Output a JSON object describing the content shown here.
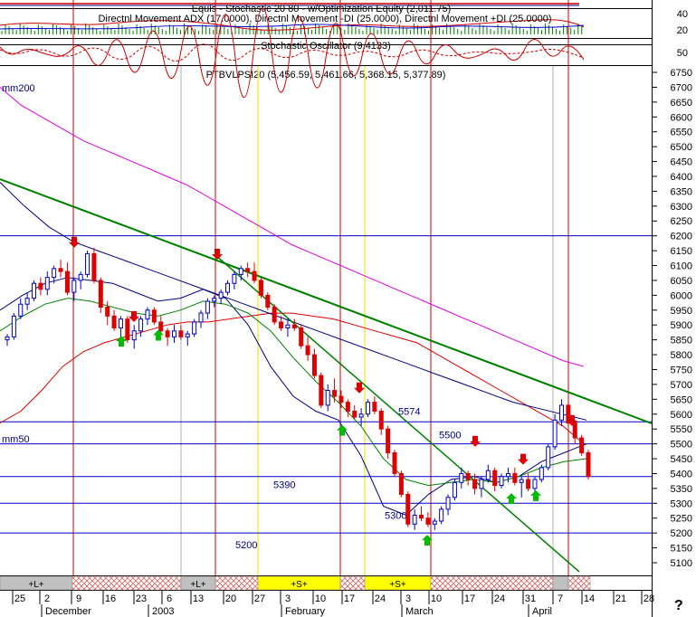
{
  "headers": {
    "equity": "Equis - Stochastic 20 80 - w/Optimization Equity (2,011.75)",
    "adx": "Directnl Movement ADX (17.0000), Directnl Movement -DI (25.0000), Directnl Movement +DI (25.0000)",
    "stoch": "Stochastic Oscillator (9.4133)",
    "price": "PTBVLPSI20 (5,456.59, 5,461.66, 5,368.15, 5,377.89)"
  },
  "panel_scales": {
    "equity": [
      "40"
    ],
    "adx": [
      "20"
    ],
    "stoch": [
      "50"
    ]
  },
  "labels": {
    "mm200": "mm200",
    "mm50": "mm50",
    "corner": "?"
  },
  "colors": {
    "up_candle": "#0000cc",
    "down_candle": "#dd0000",
    "mm200": "#dd00dd",
    "mm50": "#dd0000",
    "mm_blue": "#000080",
    "mm_green": "#008000",
    "trendline": "#008000",
    "support_line": "#0000cc",
    "buy_arrow": "#00bb00",
    "sell_arrow": "#dd0000",
    "red_vline": "#cc0000",
    "yellow_vline": "#e6e600",
    "gray_vline": "#b0b0b0"
  },
  "chart_data": {
    "type": "candlestick",
    "symbol": "PTBVLPSI20",
    "ylim": [
      5050,
      6800
    ],
    "yticks": [
      5100,
      5150,
      5200,
      5250,
      5300,
      5350,
      5400,
      5450,
      5500,
      5550,
      5600,
      5650,
      5700,
      5750,
      5800,
      5850,
      5900,
      5950,
      6000,
      6050,
      6100,
      6150,
      6200,
      6250,
      6300,
      6350,
      6400,
      6450,
      6500,
      6550,
      6600,
      6650,
      6700,
      6750
    ],
    "ytick_labels": [
      "5100",
      "5150",
      "5200",
      "5250",
      "5300",
      "5350",
      "5400",
      "5450",
      "5500",
      "5550",
      "5600",
      "5650",
      "5700",
      "5750",
      "5800",
      "5850",
      "5900",
      "5950",
      "6000",
      "6050",
      "6100",
      "6150",
      "6200",
      "6250",
      "6300",
      "6350",
      "6400",
      "6450",
      "6500",
      "6550",
      "6600",
      "6650",
      "6700",
      "6750"
    ],
    "xtick_labels": [
      "25",
      "2",
      "9",
      "16",
      "23",
      "6",
      "13",
      "20",
      "27",
      "3",
      "10",
      "17",
      "24",
      "3",
      "10",
      "17",
      "24",
      "31",
      "7",
      "14",
      "21",
      "28"
    ],
    "month_labels": [
      "December",
      "2003",
      "February",
      "March",
      "April"
    ],
    "horizontal_levels": [
      {
        "value": 6200,
        "label": ""
      },
      {
        "value": 5574,
        "label": "5574"
      },
      {
        "value": 5500,
        "label": "5500"
      },
      {
        "value": 5390,
        "label": "5390"
      },
      {
        "value": 5300,
        "label": "5300"
      },
      {
        "value": 5200,
        "label": "5200"
      }
    ],
    "signal_bar": [
      {
        "label": "+L+",
        "type": "long"
      },
      {
        "label": "",
        "type": "none"
      },
      {
        "label": "+L+",
        "type": "long"
      },
      {
        "label": "",
        "type": "none"
      },
      {
        "label": "+S+",
        "type": "short"
      },
      {
        "label": "",
        "type": "none"
      },
      {
        "label": "+S+",
        "type": "short"
      },
      {
        "label": "",
        "type": "none"
      },
      {
        "label": "",
        "type": "long"
      },
      {
        "label": "",
        "type": "none"
      }
    ],
    "candles": [
      [
        5850,
        5870,
        5830,
        5860
      ],
      [
        5860,
        5940,
        5850,
        5930
      ],
      [
        5930,
        5990,
        5920,
        5970
      ],
      [
        5970,
        6010,
        5950,
        5990
      ],
      [
        5990,
        6050,
        5980,
        6040
      ],
      [
        6040,
        6060,
        6000,
        6020
      ],
      [
        6020,
        6080,
        6000,
        6060
      ],
      [
        6060,
        6100,
        6040,
        6090
      ],
      [
        6090,
        6120,
        6060,
        6080
      ],
      [
        6080,
        6110,
        6000,
        6010
      ],
      [
        6010,
        6060,
        5980,
        6050
      ],
      [
        6050,
        6080,
        6020,
        6070
      ],
      [
        6070,
        6150,
        6060,
        6140
      ],
      [
        6140,
        6160,
        6040,
        6050
      ],
      [
        6050,
        6060,
        5940,
        5960
      ],
      [
        5960,
        5980,
        5900,
        5930
      ],
      [
        5930,
        5950,
        5880,
        5890
      ],
      [
        5890,
        5930,
        5860,
        5920
      ],
      [
        5920,
        5930,
        5840,
        5850
      ],
      [
        5850,
        5900,
        5820,
        5880
      ],
      [
        5880,
        5930,
        5860,
        5920
      ],
      [
        5920,
        5960,
        5900,
        5950
      ],
      [
        5950,
        5960,
        5900,
        5910
      ],
      [
        5910,
        5930,
        5870,
        5880
      ],
      [
        5880,
        5890,
        5830,
        5860
      ],
      [
        5860,
        5900,
        5840,
        5880
      ],
      [
        5880,
        5900,
        5850,
        5860
      ],
      [
        5860,
        5880,
        5830,
        5870
      ],
      [
        5870,
        5920,
        5860,
        5910
      ],
      [
        5910,
        5950,
        5890,
        5940
      ],
      [
        5940,
        5990,
        5920,
        5980
      ],
      [
        5980,
        6000,
        5960,
        5990
      ],
      [
        5990,
        6020,
        5970,
        6010
      ],
      [
        6010,
        6050,
        6000,
        6040
      ],
      [
        6040,
        6080,
        6020,
        6070
      ],
      [
        6070,
        6100,
        6050,
        6090
      ],
      [
        6090,
        6110,
        6060,
        6080
      ],
      [
        6080,
        6110,
        6040,
        6050
      ],
      [
        6050,
        6060,
        5990,
        6000
      ],
      [
        6000,
        6010,
        5950,
        5960
      ],
      [
        5960,
        5970,
        5900,
        5910
      ],
      [
        5910,
        5930,
        5880,
        5890
      ],
      [
        5890,
        5920,
        5860,
        5900
      ],
      [
        5900,
        5920,
        5880,
        5890
      ],
      [
        5890,
        5900,
        5820,
        5830
      ],
      [
        5830,
        5860,
        5780,
        5800
      ],
      [
        5800,
        5820,
        5720,
        5730
      ],
      [
        5730,
        5740,
        5620,
        5630
      ],
      [
        5630,
        5700,
        5610,
        5680
      ],
      [
        5680,
        5720,
        5640,
        5660
      ],
      [
        5660,
        5680,
        5620,
        5640
      ],
      [
        5640,
        5650,
        5590,
        5610
      ],
      [
        5610,
        5630,
        5580,
        5590
      ],
      [
        5590,
        5620,
        5560,
        5600
      ],
      [
        5600,
        5650,
        5590,
        5640
      ],
      [
        5640,
        5660,
        5600,
        5610
      ],
      [
        5610,
        5620,
        5530,
        5550
      ],
      [
        5550,
        5560,
        5450,
        5470
      ],
      [
        5470,
        5480,
        5390,
        5400
      ],
      [
        5400,
        5410,
        5320,
        5330
      ],
      [
        5330,
        5340,
        5220,
        5230
      ],
      [
        5230,
        5280,
        5210,
        5260
      ],
      [
        5260,
        5290,
        5240,
        5250
      ],
      [
        5250,
        5270,
        5220,
        5230
      ],
      [
        5230,
        5250,
        5210,
        5240
      ],
      [
        5240,
        5290,
        5230,
        5280
      ],
      [
        5280,
        5330,
        5260,
        5320
      ],
      [
        5320,
        5380,
        5310,
        5370
      ],
      [
        5370,
        5420,
        5350,
        5400
      ],
      [
        5400,
        5410,
        5360,
        5380
      ],
      [
        5380,
        5400,
        5330,
        5350
      ],
      [
        5350,
        5390,
        5320,
        5380
      ],
      [
        5380,
        5430,
        5370,
        5410
      ],
      [
        5410,
        5420,
        5340,
        5360
      ],
      [
        5360,
        5400,
        5350,
        5390
      ],
      [
        5390,
        5420,
        5370,
        5400
      ],
      [
        5400,
        5420,
        5360,
        5370
      ],
      [
        5370,
        5390,
        5320,
        5380
      ],
      [
        5380,
        5400,
        5340,
        5350
      ],
      [
        5350,
        5390,
        5330,
        5380
      ],
      [
        5380,
        5430,
        5370,
        5420
      ],
      [
        5420,
        5500,
        5410,
        5490
      ],
      [
        5490,
        5600,
        5480,
        5580
      ],
      [
        5580,
        5650,
        5560,
        5630
      ],
      [
        5630,
        5640,
        5560,
        5570
      ],
      [
        5570,
        5580,
        5500,
        5520
      ],
      [
        5520,
        5530,
        5460,
        5470
      ],
      [
        5470,
        5480,
        5380,
        5390
      ]
    ],
    "series": [
      {
        "name": "mm200",
        "values": [
          6700,
          6640,
          6600,
          6560,
          6520,
          6490,
          6460,
          6430,
          6400,
          6370,
          6330,
          6290,
          6250,
          6210,
          6170,
          6140,
          6110,
          6080,
          6050,
          6020,
          5990,
          5960,
          5930,
          5900,
          5870,
          5840,
          5810,
          5780,
          5760
        ]
      },
      {
        "name": "mm50",
        "values": [
          5570,
          5610,
          5680,
          5760,
          5810,
          5840,
          5860,
          5880,
          5900,
          5910,
          5910,
          5920,
          5930,
          5940,
          5940,
          5930,
          5920,
          5900,
          5880,
          5860,
          5840,
          5800,
          5760,
          5720,
          5680,
          5640,
          5600,
          5560,
          5500
        ]
      },
      {
        "name": "",
        "values": [
          5950,
          6000,
          6040,
          6060,
          6050,
          6040,
          6010,
          5980,
          5990,
          6020,
          5990,
          5900,
          5760,
          5660,
          5610,
          5580,
          5460,
          5290,
          5260,
          5330,
          5380,
          5390,
          5370,
          5390,
          5440,
          5470,
          5500
        ]
      },
      {
        "name": "",
        "values": [
          5880,
          5930,
          5970,
          5990,
          5980,
          5960,
          5940,
          5930,
          5950,
          5980,
          5970,
          5940,
          5880,
          5790,
          5710,
          5640,
          5560,
          5450,
          5380,
          5360,
          5370,
          5380,
          5370,
          5390,
          5420,
          5440,
          5450
        ]
      },
      {
        "name": "",
        "values": [
          6380,
          6300,
          6230,
          6180,
          6150,
          6120,
          6090,
          6060,
          6030,
          6000,
          5970,
          5940,
          5910,
          5880,
          5850,
          5820,
          5790,
          5760,
          5730,
          5700,
          5670,
          5640,
          5620,
          5600,
          5580
        ]
      }
    ]
  }
}
